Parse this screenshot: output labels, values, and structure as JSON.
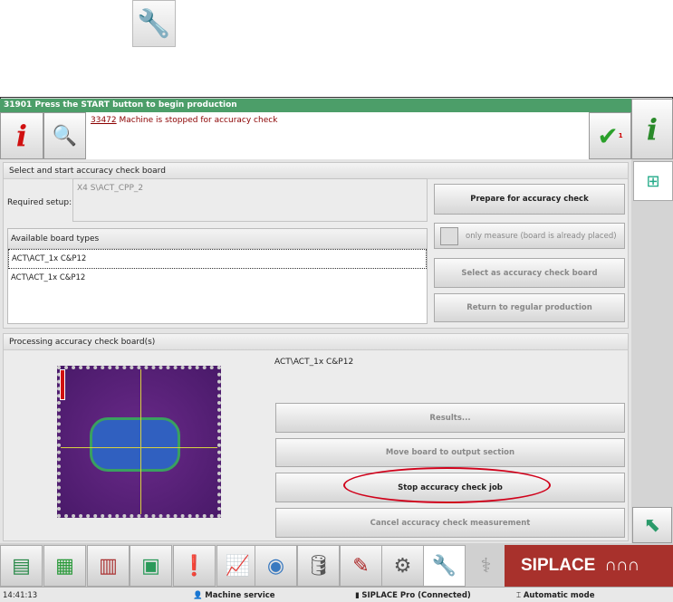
{
  "header": {
    "status_message": "31901 Press the START button to begin production",
    "message_code": "33472",
    "message_text": " Machine is stopped for accuracy check",
    "check_count": "1"
  },
  "setup": {
    "section_title": "Select and start accuracy check board",
    "required_label": "Required setup:",
    "required_value": "X4 S\\ACT_CPP_2"
  },
  "boards": {
    "header": "Available board types",
    "items": [
      "ACT\\ACT_1x C&P12",
      "ACT\\ACT_1x C&P12"
    ]
  },
  "actions": {
    "prepare": "Prepare for accuracy check",
    "only_measure": "only measure (board is already placed)",
    "select": "Select as accuracy check board",
    "return": "Return to regular production"
  },
  "processing": {
    "section_title": "Processing accuracy check board(s)",
    "board_name": "ACT\\ACT_1x C&P12",
    "results": "Results...",
    "move": "Move board to output section",
    "stop": "Stop accuracy check job",
    "cancel": "Cancel accuracy check measurement"
  },
  "logo": "SIPLACE",
  "statusbar": {
    "time": "14:41:13",
    "mode_service": "Machine service",
    "connection": "SIPLACE Pro (Connected)",
    "auto": "Automatic mode"
  },
  "colors": {
    "green_bar": "#4c9e69",
    "logo_bg": "#a8312c",
    "highlight": "#d0021b"
  }
}
